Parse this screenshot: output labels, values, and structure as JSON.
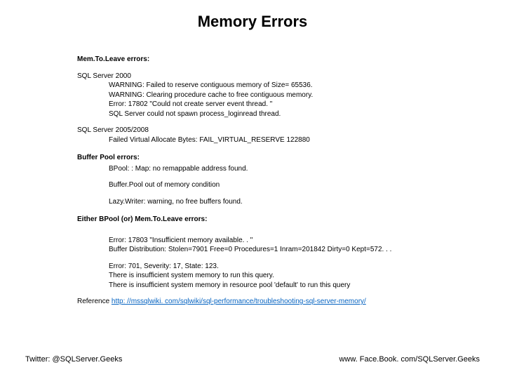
{
  "title": "Memory Errors",
  "sections": {
    "memtoleave_heading": "Mem.To.Leave errors:",
    "sql2000_label": "SQL Server 2000",
    "sql2000_lines": [
      "WARNING: Failed to reserve contiguous memory of Size= 65536.",
      "WARNING: Clearing procedure cache to free contiguous memory.",
      "Error: 17802 \"Could not create server event thread. \"",
      "SQL Server could not spawn process_loginread thread."
    ],
    "sql2005_label": "SQL Server 2005/2008",
    "sql2005_lines": [
      "Failed Virtual Allocate Bytes: FAIL_VIRTUAL_RESERVE 122880"
    ],
    "bufferpool_heading": "Buffer Pool errors:",
    "bufferpool_blocks": [
      "BPool: : Map: no remappable address found.",
      "Buffer.Pool out of memory condition",
      "Lazy.Writer: warning, no free buffers found."
    ],
    "either_heading": "Either BPool (or) Mem.To.Leave errors:",
    "either_block1": [
      "Error: 17803 \"Insufficient memory available. . \"",
      "Buffer Distribution:  Stolen=7901 Free=0 Procedures=1 Inram=201842 Dirty=0 Kept=572. . ."
    ],
    "either_block2": [
      "Error: 701, Severity: 17, State: 123.",
      "There is insufficient system memory to run this query.",
      "There is insufficient system memory in resource pool 'default' to run this query"
    ],
    "reference_label": "Reference ",
    "reference_link_text": "http: //mssqlwiki. com/sqlwiki/sql-performance/troubleshooting-sql-server-memory/"
  },
  "footer": {
    "left": "Twitter: @SQLServer.Geeks",
    "right": "www. Face.Book. com/SQLServer.Geeks"
  }
}
